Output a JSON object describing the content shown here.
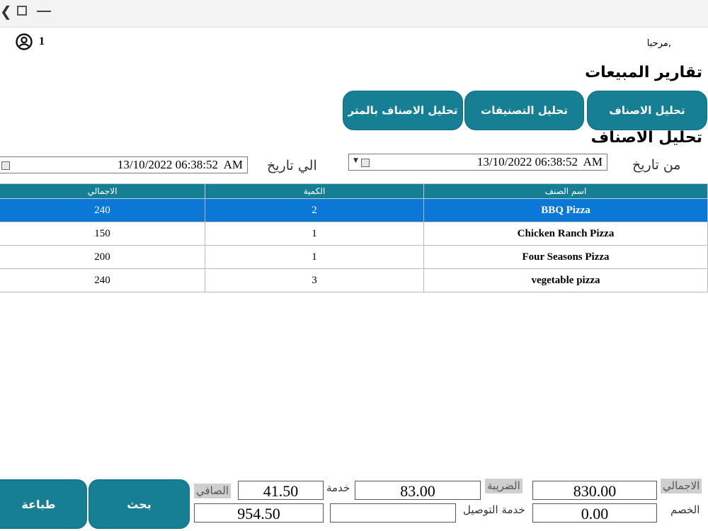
{
  "window": {
    "controls": {
      "back": "❮",
      "maximize": "□",
      "minimize": "—"
    }
  },
  "header": {
    "user_number": "1",
    "welcome": "مرحبا,",
    "page_title": "تقارير المبيعات",
    "section_title": "تحليل الاصناف"
  },
  "tabs": [
    {
      "label": "تحليل الاصناف"
    },
    {
      "label": "تحليل التصنيفات"
    },
    {
      "label": "تحليل الاصناف بالمتر"
    }
  ],
  "filters": {
    "from_label": "من تاريخ",
    "from_value": "13/10/2022 06:38:52  AM",
    "to_label": "الي تاريخ",
    "to_value": "13/10/2022 06:38:52  AM"
  },
  "table": {
    "columns": [
      "اسم الصنف",
      "الكمية",
      "الاجمالي"
    ],
    "rows": [
      {
        "name": "BBQ Pizza",
        "qty": "2",
        "total": "240"
      },
      {
        "name": "Chicken Ranch Pizza",
        "qty": "1",
        "total": "150"
      },
      {
        "name": "Four Seasons Pizza",
        "qty": "1",
        "total": "200"
      },
      {
        "name": "vegetable pizza",
        "qty": "3",
        "total": "240"
      }
    ]
  },
  "summary": {
    "total_label": "الاجمالي",
    "total_value": "830.00",
    "discount_label": "الخصم",
    "discount_value": "0.00",
    "tax_label": "الضريبة",
    "tax_value": "83.00",
    "delivery_label": "خدمة التوصيل",
    "delivery_value": "",
    "service_label": "خدمة",
    "service_value": "41.50",
    "net_label": "الصافي",
    "net_value": "954.50"
  },
  "actions": {
    "search": "بحث",
    "print": "طباعة"
  }
}
